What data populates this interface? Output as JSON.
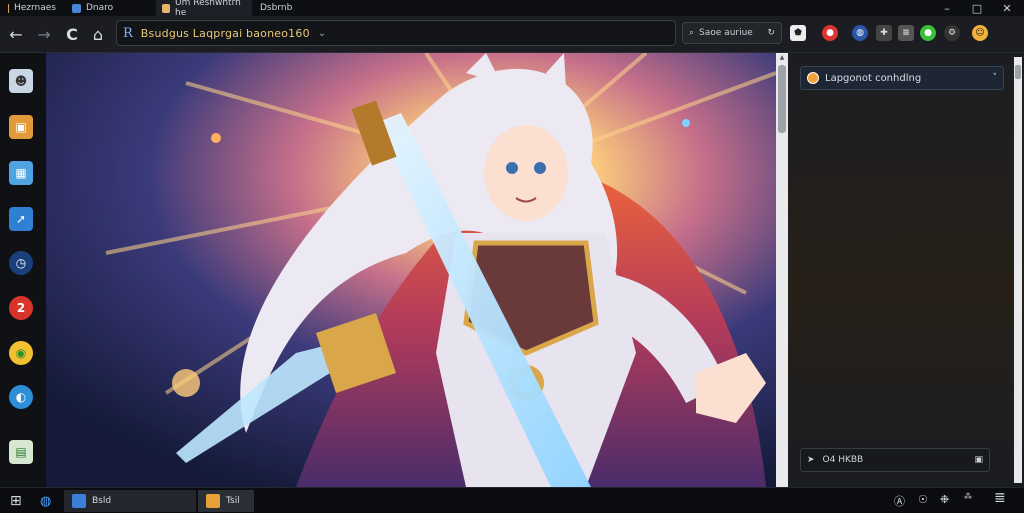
{
  "tabs": [
    {
      "label": "Hezrnaes",
      "icon": "app-icon"
    },
    {
      "label": "Dnaro",
      "icon": "doc-icon"
    },
    {
      "label": "Um Reshwhtrh he",
      "icon": "page-icon"
    },
    {
      "label": "Dsbrnb",
      "icon": "page-icon"
    }
  ],
  "window_controls": {
    "minimize": "–",
    "maximize": "□",
    "close": "✕"
  },
  "toolbar": {
    "back": "←",
    "forward": "→",
    "reload": "C",
    "home": "⌂",
    "address_icon": "R",
    "address_text": "Bsudgus  Laqprgai baoneo160",
    "address_dropdown": "⌄",
    "search_text": "Saoe auriue"
  },
  "dock_icons": [
    "avatar-icon",
    "cube-icon",
    "photo-icon",
    "arrow-icon",
    "clock-icon",
    "game-icon",
    "chrome-icon",
    "browser-icon",
    "file-icon"
  ],
  "art": {
    "alt": "anime-warrior-wallpaper"
  },
  "panel": {
    "select_label": "Lapgonot conhdlng",
    "select_chevron": "˅",
    "input_text": "O4 HKBB"
  },
  "taskbar": {
    "start": "⊞",
    "tasks": [
      {
        "label": "Bsld"
      },
      {
        "label": "Tsil"
      }
    ],
    "tray": [
      "Ⓐ",
      "☉",
      "❉",
      "≣"
    ]
  },
  "colors": {
    "accent": "#e8c878",
    "panel_select": "#1f2633",
    "dark": "#111317"
  }
}
